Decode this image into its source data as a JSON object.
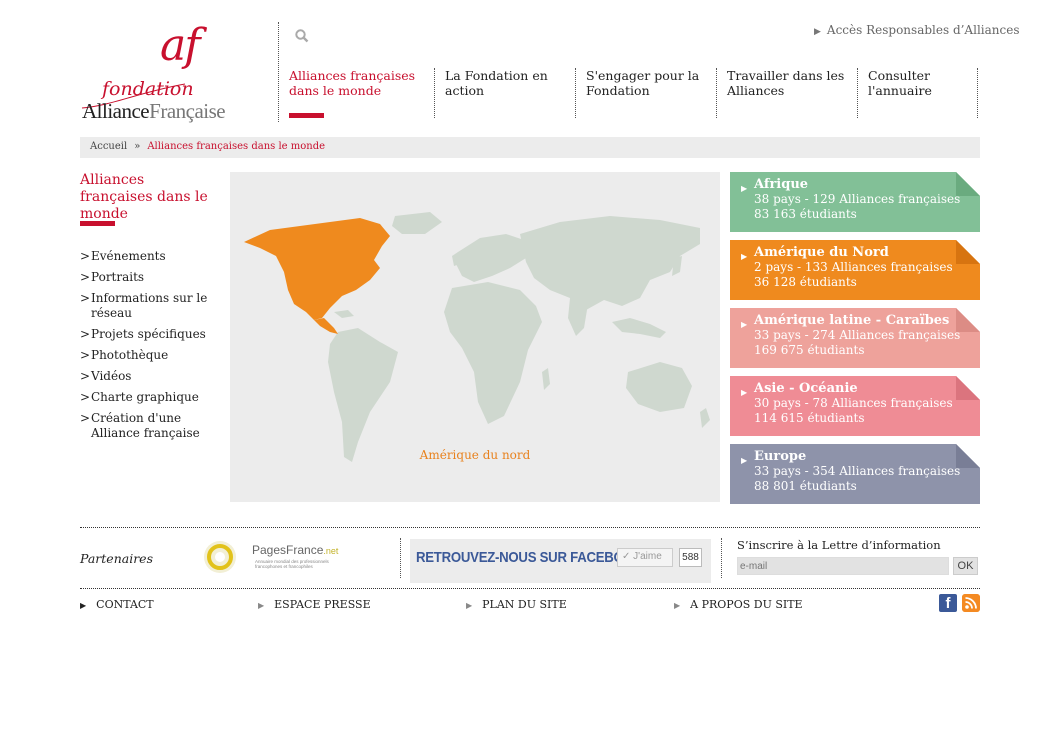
{
  "logo": {
    "initials": "af",
    "line1": "fondation",
    "name_part1": "Alliance",
    "name_part2": "Française"
  },
  "header": {
    "top_link": "Accès Responsables d’Alliances",
    "nav": [
      {
        "label": "Alliances françaises dans le monde",
        "active": true
      },
      {
        "label": "La Fondation en action"
      },
      {
        "label": "S'engager pour la Fondation"
      },
      {
        "label": "Travailler dans les Alliances"
      },
      {
        "label": "Consulter l'annuaire"
      }
    ]
  },
  "breadcrumb": {
    "home": "Accueil",
    "sep": "»",
    "current": "Alliances françaises dans le monde"
  },
  "sidebar": {
    "title": "Alliances françaises dans le monde",
    "items": [
      "Evénements",
      "Portraits",
      "Informations sur le réseau",
      "Projets spécifiques",
      "Photothèque",
      "Vidéos",
      "Charte graphique",
      "Création d'une Alliance française"
    ]
  },
  "map": {
    "label": "Amérique du nord",
    "highlight_color": "#ef8a1e",
    "land_color": "#cfd8cf"
  },
  "regions": [
    {
      "name": "Afrique",
      "line1": "38 pays - 129 Alliances françaises",
      "line2": "83 163 étudiants",
      "color": "#82c097"
    },
    {
      "name": "Amérique du Nord",
      "line1": "2 pays - 133 Alliances françaises",
      "line2": "36 128 étudiants",
      "color": "#ef8a1e"
    },
    {
      "name": "Amérique latine - Caraïbes",
      "line1": "33 pays - 274 Alliances françaises",
      "line2": "169 675 étudiants",
      "color": "#eea29b"
    },
    {
      "name": "Asie - Océanie",
      "line1": "30 pays - 78 Alliances françaises",
      "line2": "114 615 étudiants",
      "color": "#ef8c95"
    },
    {
      "name": "Europe",
      "line1": "33 pays - 354 Alliances françaises",
      "line2": "88 801 étudiants",
      "color": "#8e93aa"
    }
  ],
  "footer": {
    "partners_label": "Partenaires",
    "pagesfrance_name": "PagesFrance",
    "pagesfrance_net": ".net",
    "pagesfrance_sub": "Annuaire mondial des professionnels francophones et francophiles",
    "facebook_text": "RETROUVEZ-NOUS SUR FACEBOOK",
    "like_label": "J'aime",
    "like_count": "588",
    "newsletter_label": "S’inscrire à la Lettre d’information",
    "newsletter_placeholder": "e-mail",
    "newsletter_button": "OK",
    "links": [
      "CONTACT",
      "ESPACE PRESSE",
      "PLAN DU SITE",
      "A PROPOS DU SITE"
    ]
  }
}
